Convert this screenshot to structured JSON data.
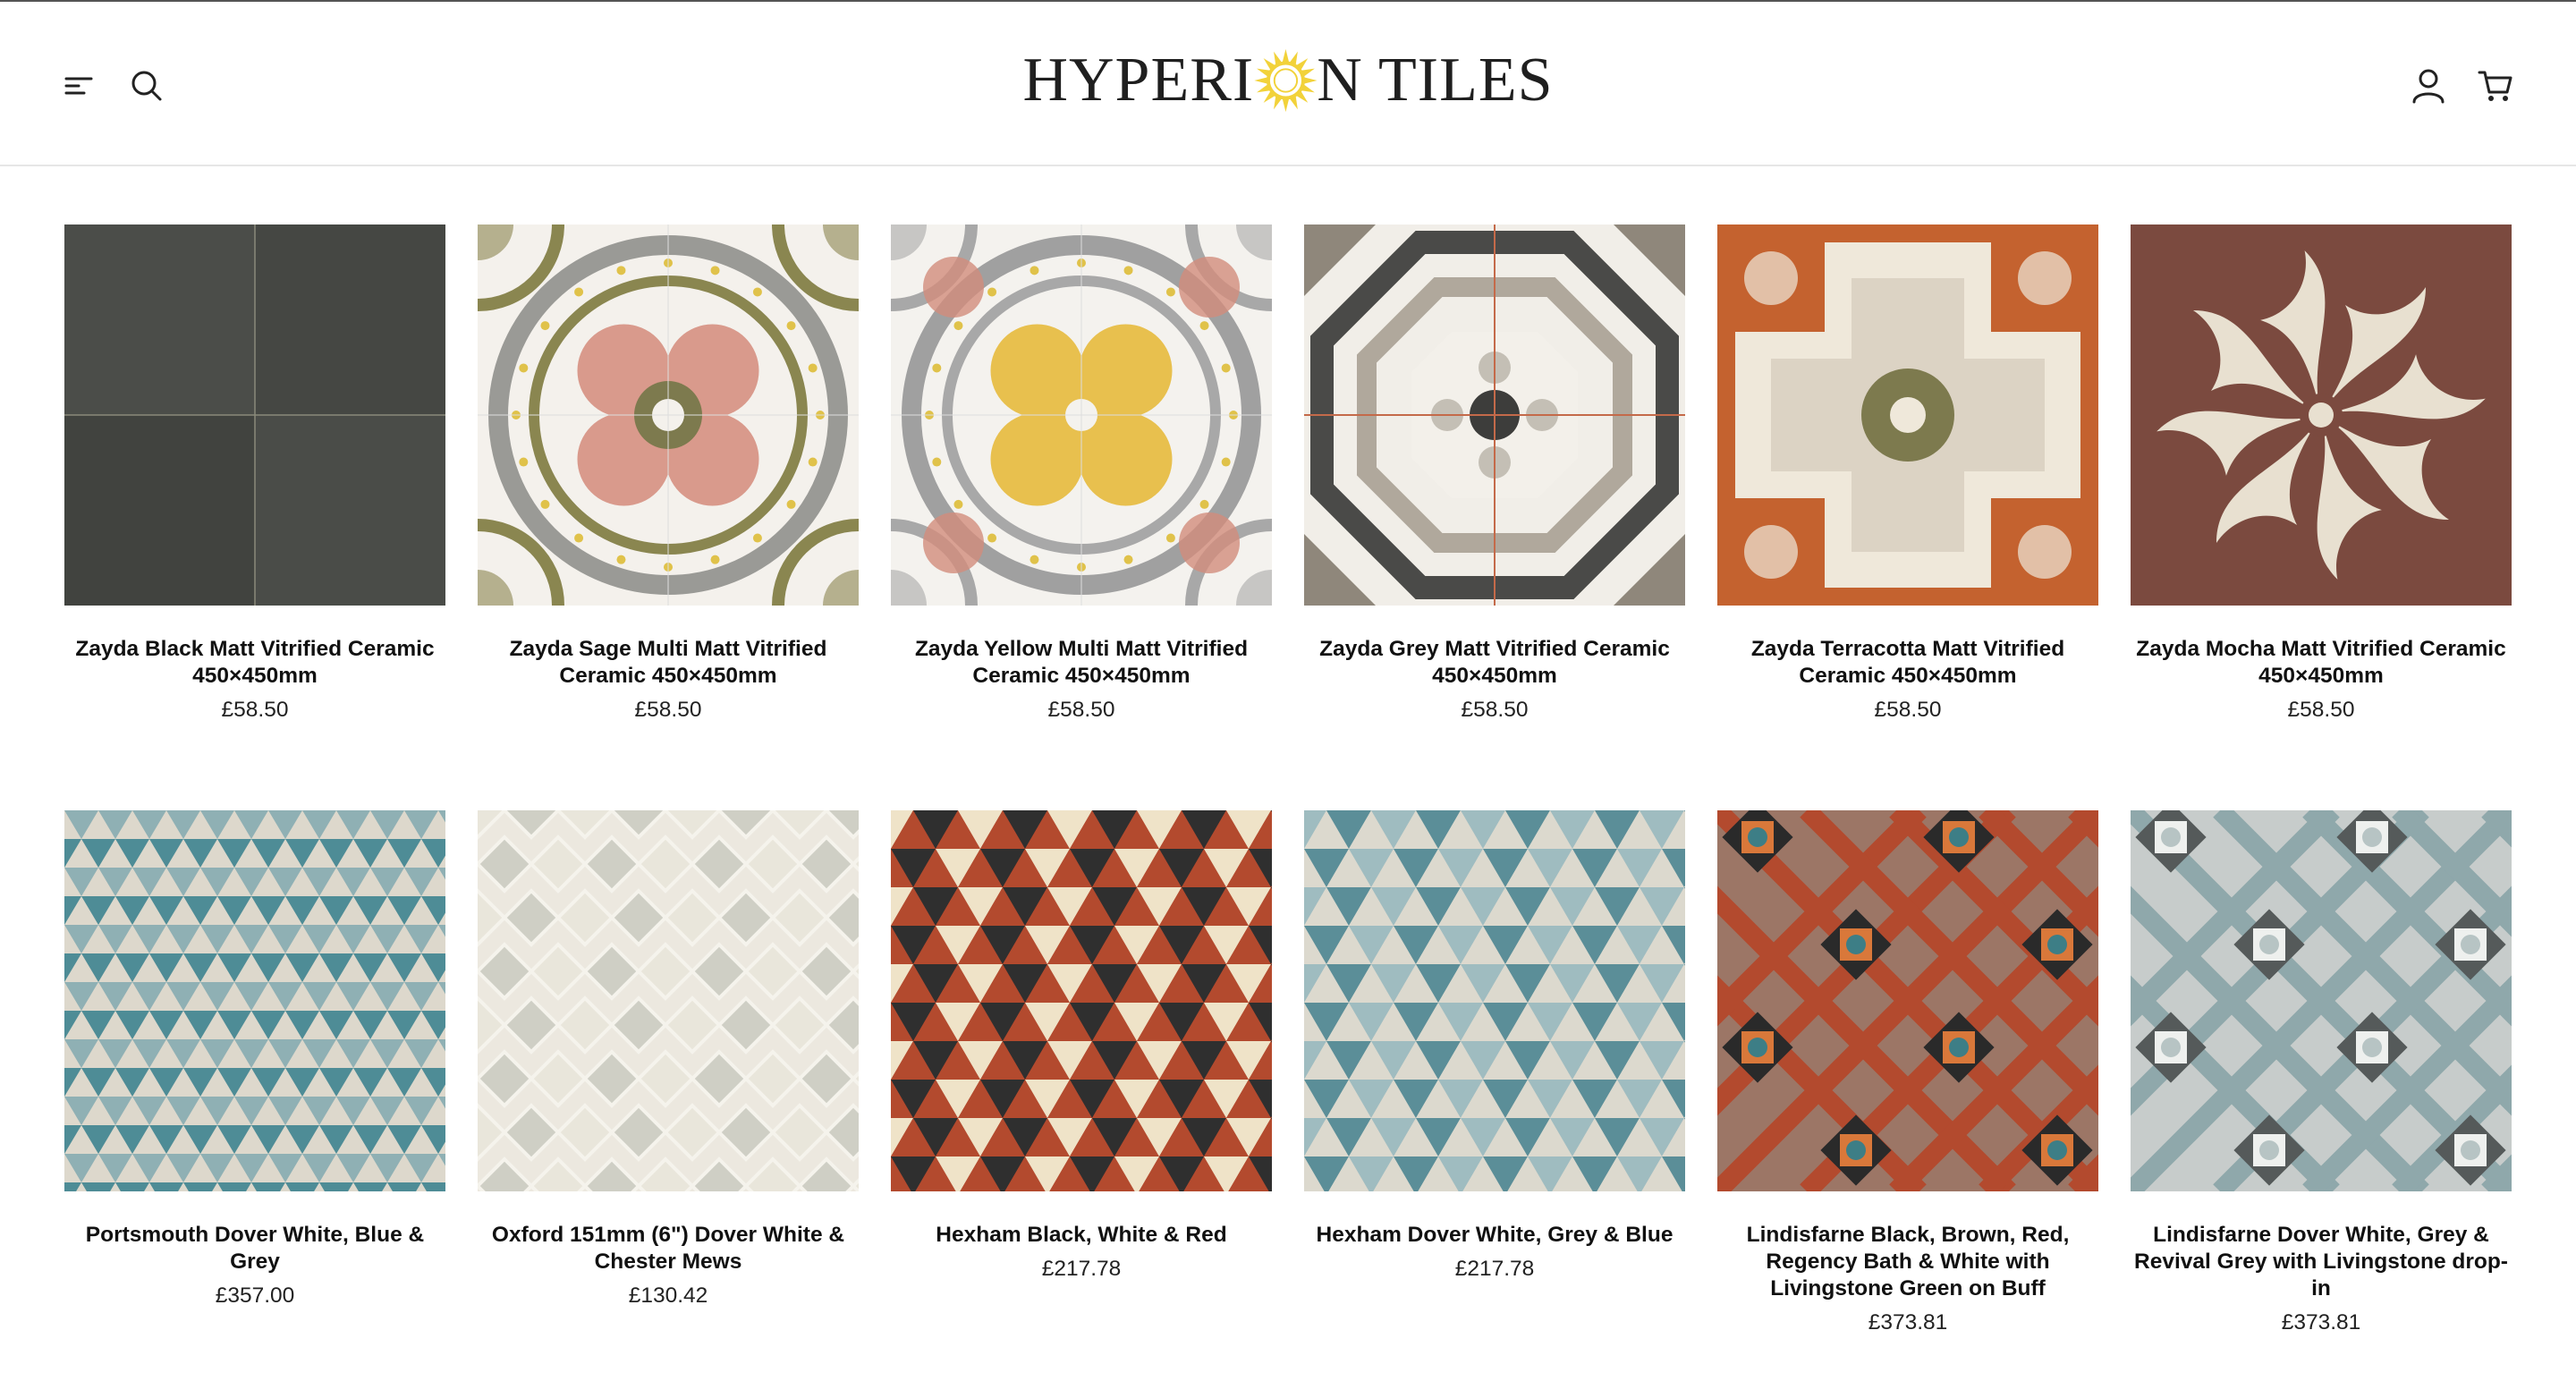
{
  "header": {
    "logo_text_left": "HYPERI",
    "logo_text_right": "N TILES",
    "menu_icon": "menu-icon",
    "search_icon": "search-icon",
    "account_icon": "user-icon",
    "cart_icon": "cart-icon",
    "logo_sun_color": "#f2d23a"
  },
  "products": [
    {
      "title": "Zayda Black Matt Vitrified Ceramic 450×450mm",
      "price": "£58.50",
      "pattern": "black-plain"
    },
    {
      "title": "Zayda Sage Multi Matt Vitrified Ceramic 450×450mm",
      "price": "£58.50",
      "pattern": "sage-medallion"
    },
    {
      "title": "Zayda Yellow Multi Matt Vitrified Ceramic 450×450mm",
      "price": "£58.50",
      "pattern": "yellow-medallion"
    },
    {
      "title": "Zayda Grey Matt Vitrified Ceramic 450×450mm",
      "price": "£58.50",
      "pattern": "grey-octagon"
    },
    {
      "title": "Zayda Terracotta Matt Vitrified Ceramic 450×450mm",
      "price": "£58.50",
      "pattern": "terracotta-floral"
    },
    {
      "title": "Zayda Mocha Matt Vitrified Ceramic 450×450mm",
      "price": "£58.50",
      "pattern": "mocha-scroll"
    },
    {
      "title": "Portsmouth Dover White, Blue & Grey",
      "price": "£357.00",
      "pattern": "triangles-blue"
    },
    {
      "title": "Oxford 151mm (6\") Dover White & Chester Mews",
      "price": "£130.42",
      "pattern": "diamond-cream"
    },
    {
      "title": "Hexham Black, White & Red",
      "price": "£217.78",
      "pattern": "hex-red"
    },
    {
      "title": "Hexham Dover White, Grey & Blue",
      "price": "£217.78",
      "pattern": "hex-blue"
    },
    {
      "title": "Lindisfarne Black, Brown, Red, Regency Bath & White with Livingstone Green on Buff",
      "price": "£373.81",
      "pattern": "victorian-red"
    },
    {
      "title": "Lindisfarne Dover White, Grey & Revival Grey with Livingstone drop-in",
      "price": "£373.81",
      "pattern": "victorian-grey"
    }
  ],
  "colors": {
    "charcoal": "#4a4c48",
    "sage_green": "#7d7a4e",
    "pink": "#d99a8c",
    "yellow": "#e8c04e",
    "terracotta": "#c4622f",
    "mocha": "#7b4a3f",
    "teal": "#4e8c96",
    "brick_red": "#b34a2e"
  }
}
